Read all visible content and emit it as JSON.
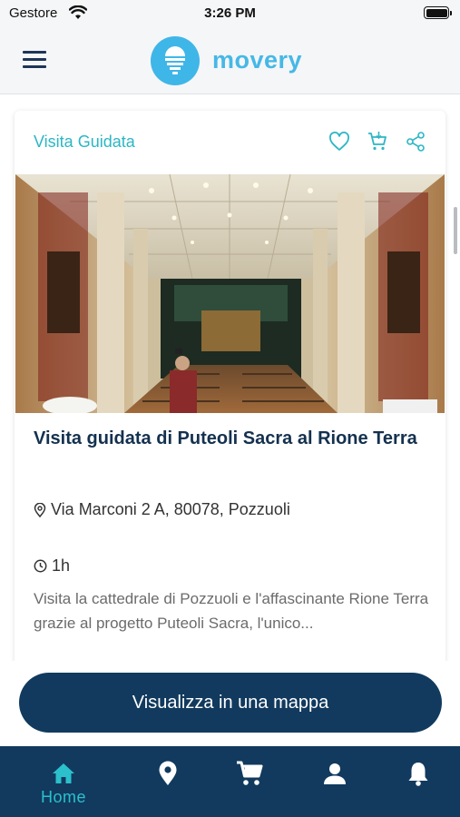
{
  "status_bar": {
    "carrier": "Gestore",
    "time": "3:26 PM",
    "battery_level": 1.0
  },
  "header": {
    "menu_icon": "hamburger-menu-icon",
    "logo_icon": "lightbulb-icon",
    "logo_text": "movery"
  },
  "card": {
    "category": "Visita Guidata",
    "actions": [
      "heart-icon",
      "add-to-cart-icon",
      "share-icon"
    ],
    "image_desc": "cathedral-interior-photo",
    "title": "Visita guidata di Puteoli Sacra al Rione Terra",
    "address": "Via Marconi 2 A, 80078, Pozzuoli",
    "duration": "1h",
    "description": "Visita la cattedrale di Pozzuoli e l'affascinante Rione Terra grazie al progetto Puteoli Sacra, l'unico..."
  },
  "map_button": {
    "label": "Visualizza in una mappa"
  },
  "tab_bar": {
    "active": "Home",
    "items": [
      {
        "icon": "home-icon",
        "label": "Home"
      },
      {
        "icon": "location-pin-icon",
        "label": ""
      },
      {
        "icon": "cart-icon",
        "label": ""
      },
      {
        "icon": "user-icon",
        "label": ""
      },
      {
        "icon": "bell-icon",
        "label": ""
      }
    ]
  },
  "colors": {
    "primary": "#113a5e",
    "accent": "#2bb7c4",
    "logo": "#3fb6e8"
  }
}
